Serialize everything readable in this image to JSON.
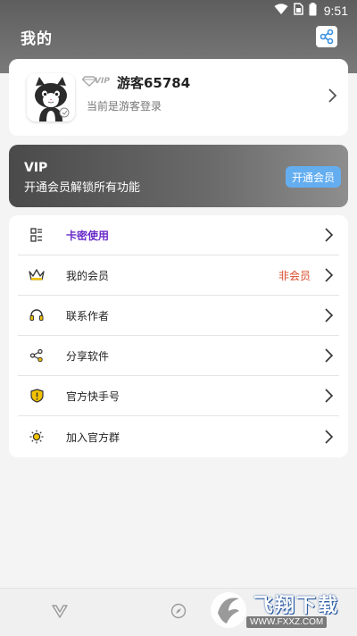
{
  "status_bar": {
    "time": "9:51",
    "icons": [
      "wifi-icon",
      "sim-icon",
      "battery-icon"
    ]
  },
  "header": {
    "title": "我的",
    "share_icon": "share-icon"
  },
  "profile": {
    "vip_badge": "VIP",
    "username": "游客65784",
    "status": "当前是游客登录"
  },
  "vip_banner": {
    "title": "VIP",
    "subtitle": "开通会员解锁所有功能",
    "button_label": "开通会员"
  },
  "menu": {
    "items": [
      {
        "label": "卡密使用",
        "icon": "qr-card-icon",
        "value": ""
      },
      {
        "label": "我的会员",
        "icon": "crown-icon",
        "value": "非会员"
      },
      {
        "label": "联系作者",
        "icon": "headset-icon",
        "value": ""
      },
      {
        "label": "分享软件",
        "icon": "share-icon",
        "value": ""
      },
      {
        "label": "官方快手号",
        "icon": "shield-icon",
        "value": ""
      },
      {
        "label": "加入官方群",
        "icon": "sun-icon",
        "value": ""
      }
    ]
  },
  "bottom_nav": {
    "items": [
      "v-logo-icon",
      "compass-icon"
    ]
  },
  "watermark": {
    "text": "飞翔下载",
    "url": "WWW.FXXZ.COM"
  },
  "colors": {
    "accent_purple": "#6a2cc9",
    "status_red": "#d94b2b",
    "button_blue": "#64aef0"
  }
}
